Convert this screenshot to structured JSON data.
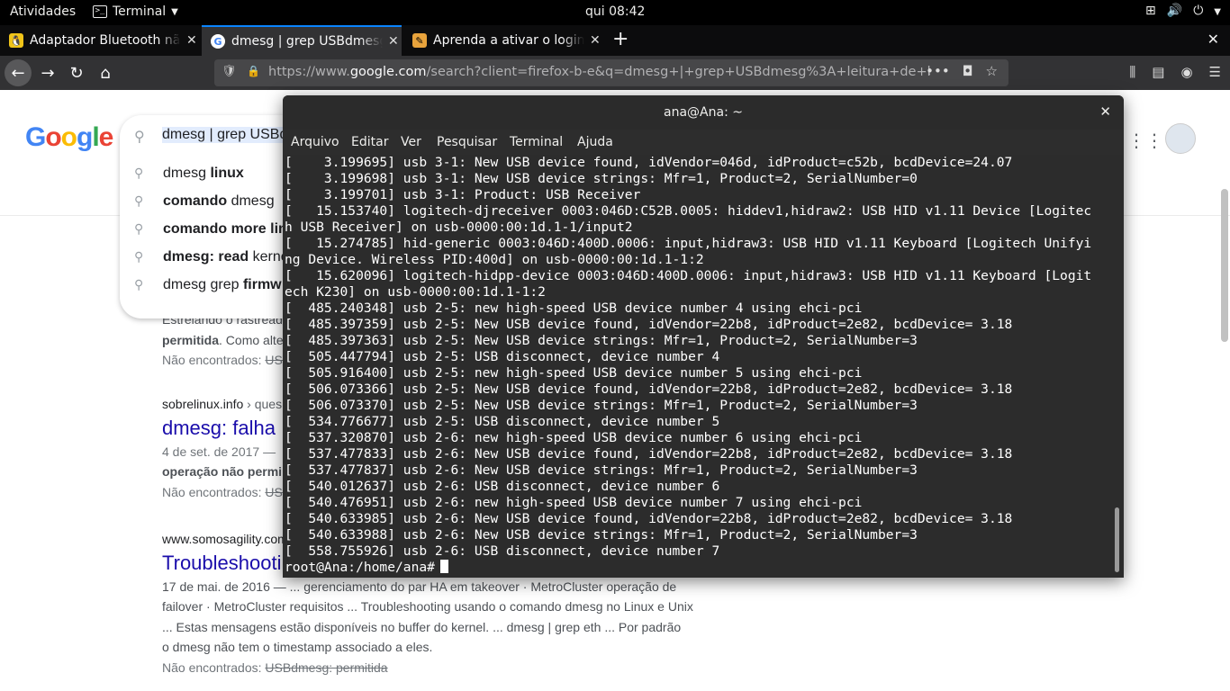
{
  "topbar": {
    "activities": "Atividades",
    "app_name": "Terminal",
    "clock": "qui 08:42"
  },
  "tabs": [
    {
      "title": "Adaptador Bluetooth não",
      "icon": "penguin-icon"
    },
    {
      "title": "dmesg | grep USBdmesg",
      "icon": "google-g-icon"
    },
    {
      "title": "Aprenda a ativar o login c",
      "icon": "site-icon"
    }
  ],
  "urlbar": {
    "url_prefix": "https://www.",
    "url_domain": "google.com",
    "url_rest": "/search?client=firefox-b-e&q=dmesg+|+grep+USBdmesg%3A+leitura+de+buffer"
  },
  "google": {
    "logo": "Google",
    "query": "dmesg | grep USBd",
    "suggestions": [
      {
        "plain": "dmesg ",
        "bold": "linux"
      },
      {
        "bold": "comando",
        "plain": " dmesg"
      },
      {
        "bold": "comando more lin",
        "plain": ""
      },
      {
        "bold": "dmesg: read",
        "plain": " kerne"
      },
      {
        "plain": "dmesg grep ",
        "bold": "firmw"
      }
    ],
    "results": [
      {
        "snippet_a": "Estreiando o rastread",
        "snippet_b_bold": "permitida",
        "snippet_b": ". Como alte",
        "notfound_label": "Não encontrados:",
        "notfound_struck": "USB"
      },
      {
        "site": "sobrelinux.info",
        "site_path": " › ques",
        "title": "dmesg: falha",
        "date_line": "4 de set. de 2017 — ",
        "snippet_bold": "operação não permi",
        "notfound_label": "Não encontrados:",
        "notfound_struck": "US"
      },
      {
        "site": "www.somosagility.com",
        "title": "Troubleshooti",
        "line1": "17 de mai. de 2016 — ... gerenciamento do par HA em takeover · MetroCluster operação de",
        "line2": "failover · MetroCluster requisitos ... Troubleshooting usando o comando dmesg no Linux e Unix",
        "line3": "... Estas mensagens estão disponíveis no buffer do kernel. ... dmesg | grep eth ... Por padrão",
        "line4": "o dmesg não tem o timestamp associado a eles.",
        "notfound_label": "Não encontrados:",
        "notfound_struck": "USBdmesg: permitida"
      }
    ]
  },
  "terminal": {
    "title": "ana@Ana: ~",
    "menu": [
      "Arquivo",
      "Editar",
      "Ver",
      "Pesquisar",
      "Terminal",
      "Ajuda"
    ],
    "lines": [
      "[    3.199695] usb 3-1: New USB device found, idVendor=046d, idProduct=c52b, bcdDevice=24.07",
      "[    3.199698] usb 3-1: New USB device strings: Mfr=1, Product=2, SerialNumber=0",
      "[    3.199701] usb 3-1: Product: USB Receiver",
      "[   15.153740] logitech-djreceiver 0003:046D:C52B.0005: hiddev1,hidraw2: USB HID v1.11 Device [Logitec",
      "h USB Receiver] on usb-0000:00:1d.1-1/input2",
      "[   15.274785] hid-generic 0003:046D:400D.0006: input,hidraw3: USB HID v1.11 Keyboard [Logitech Unifyi",
      "ng Device. Wireless PID:400d] on usb-0000:00:1d.1-1:2",
      "[   15.620096] logitech-hidpp-device 0003:046D:400D.0006: input,hidraw3: USB HID v1.11 Keyboard [Logit",
      "ech K230] on usb-0000:00:1d.1-1:2",
      "[  485.240348] usb 2-5: new high-speed USB device number 4 using ehci-pci",
      "[  485.397359] usb 2-5: New USB device found, idVendor=22b8, idProduct=2e82, bcdDevice= 3.18",
      "[  485.397363] usb 2-5: New USB device strings: Mfr=1, Product=2, SerialNumber=3",
      "[  505.447794] usb 2-5: USB disconnect, device number 4",
      "[  505.916400] usb 2-5: new high-speed USB device number 5 using ehci-pci",
      "[  506.073366] usb 2-5: New USB device found, idVendor=22b8, idProduct=2e82, bcdDevice= 3.18",
      "[  506.073370] usb 2-5: New USB device strings: Mfr=1, Product=2, SerialNumber=3",
      "[  534.776677] usb 2-5: USB disconnect, device number 5",
      "[  537.320870] usb 2-6: new high-speed USB device number 6 using ehci-pci",
      "[  537.477833] usb 2-6: New USB device found, idVendor=22b8, idProduct=2e82, bcdDevice= 3.18",
      "[  537.477837] usb 2-6: New USB device strings: Mfr=1, Product=2, SerialNumber=3",
      "[  540.012637] usb 2-6: USB disconnect, device number 6",
      "[  540.476951] usb 2-6: new high-speed USB device number 7 using ehci-pci",
      "[  540.633985] usb 2-6: New USB device found, idVendor=22b8, idProduct=2e82, bcdDevice= 3.18",
      "[  540.633988] usb 2-6: New USB device strings: Mfr=1, Product=2, SerialNumber=3",
      "[  558.755926] usb 2-6: USB disconnect, device number 7"
    ],
    "prompt": "root@Ana:/home/ana# "
  }
}
